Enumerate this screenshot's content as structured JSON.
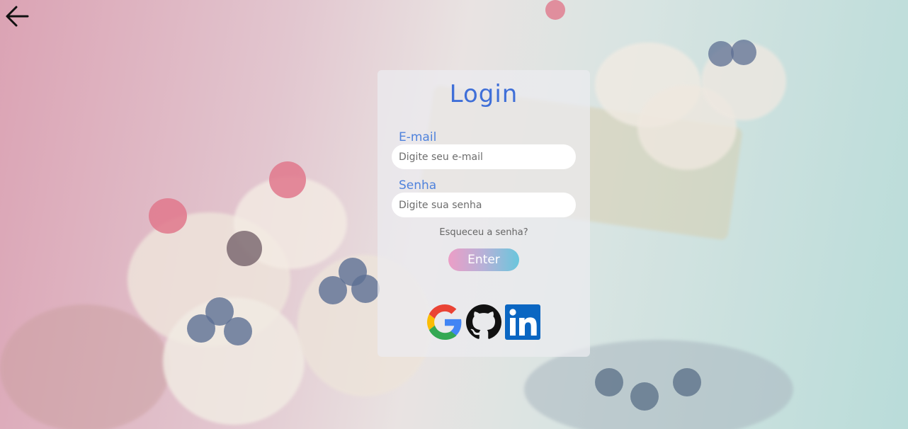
{
  "colors": {
    "title": "#3f6fd8",
    "label": "#4f82dc",
    "button_gradient_start": "#ec9ec6",
    "button_gradient_end": "#69c6dc",
    "linkedin_blue": "#0a66c2"
  },
  "nav": {
    "back_icon": "arrow-left-icon"
  },
  "login": {
    "title": "Login",
    "email_label": "E-mail",
    "email_placeholder": "Digite seu e-mail",
    "password_label": "Senha",
    "password_placeholder": "Digite sua senha",
    "forgot_password": "Esqueceu a senha?",
    "submit_label": "Enter"
  },
  "social": {
    "providers": [
      "google-icon",
      "github-icon",
      "linkedin-icon"
    ]
  }
}
